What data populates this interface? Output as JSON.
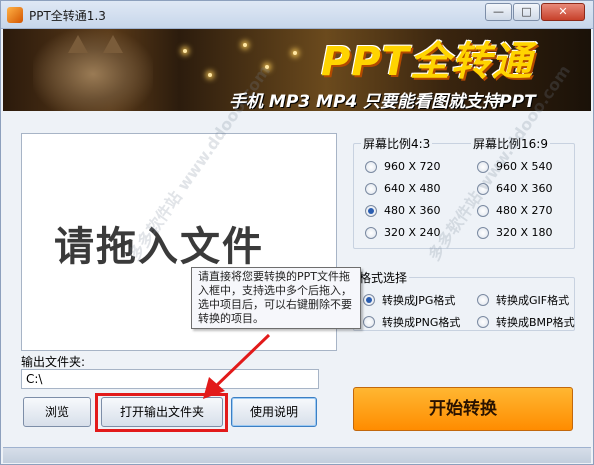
{
  "window": {
    "title": "PPT全转通1.3",
    "minimize_glyph": "—",
    "maximize_glyph": "□",
    "close_glyph": "✕"
  },
  "banner": {
    "title": "PPT全转通",
    "subtitle": "手机 MP3 MP4 只要能看图就支持PPT"
  },
  "dropzone": {
    "hint": "请拖入文件"
  },
  "tooltip": {
    "text": "请直接将您要转换的PPT文件拖入框中，支持选中多个后拖入，选中项目后，可以右键删除不要转换的项目。"
  },
  "ratio_4_3": {
    "title": "屏幕比例4:3",
    "options": [
      "960 X 720",
      "640 X 480",
      "480 X 360",
      "320 X 240"
    ],
    "selected_index": 2
  },
  "ratio_16_9": {
    "title": "屏幕比例16:9",
    "options": [
      "960 X 540",
      "640 X 360",
      "480 X 270",
      "320 X 180"
    ]
  },
  "format": {
    "title": "格式选择",
    "options": [
      "转换成JPG格式",
      "转换成GIF格式",
      "转换成PNG格式",
      "转换成BMP格式"
    ],
    "selected_index": 0
  },
  "output": {
    "label": "输出文件夹:",
    "value": "C:\\"
  },
  "buttons": {
    "browse": "浏览",
    "open_output": "打开输出文件夹",
    "help": "使用说明",
    "start": "开始转换"
  },
  "watermark": {
    "text": "多多软件站 www.ddooo.com"
  },
  "colors": {
    "highlight_red": "#e21a1a",
    "start_orange": "#ff9a10",
    "banner_yellow": "#ffd400"
  },
  "icons": {
    "app": "ppt-app-icon",
    "arrow": "red-arrow-icon"
  }
}
